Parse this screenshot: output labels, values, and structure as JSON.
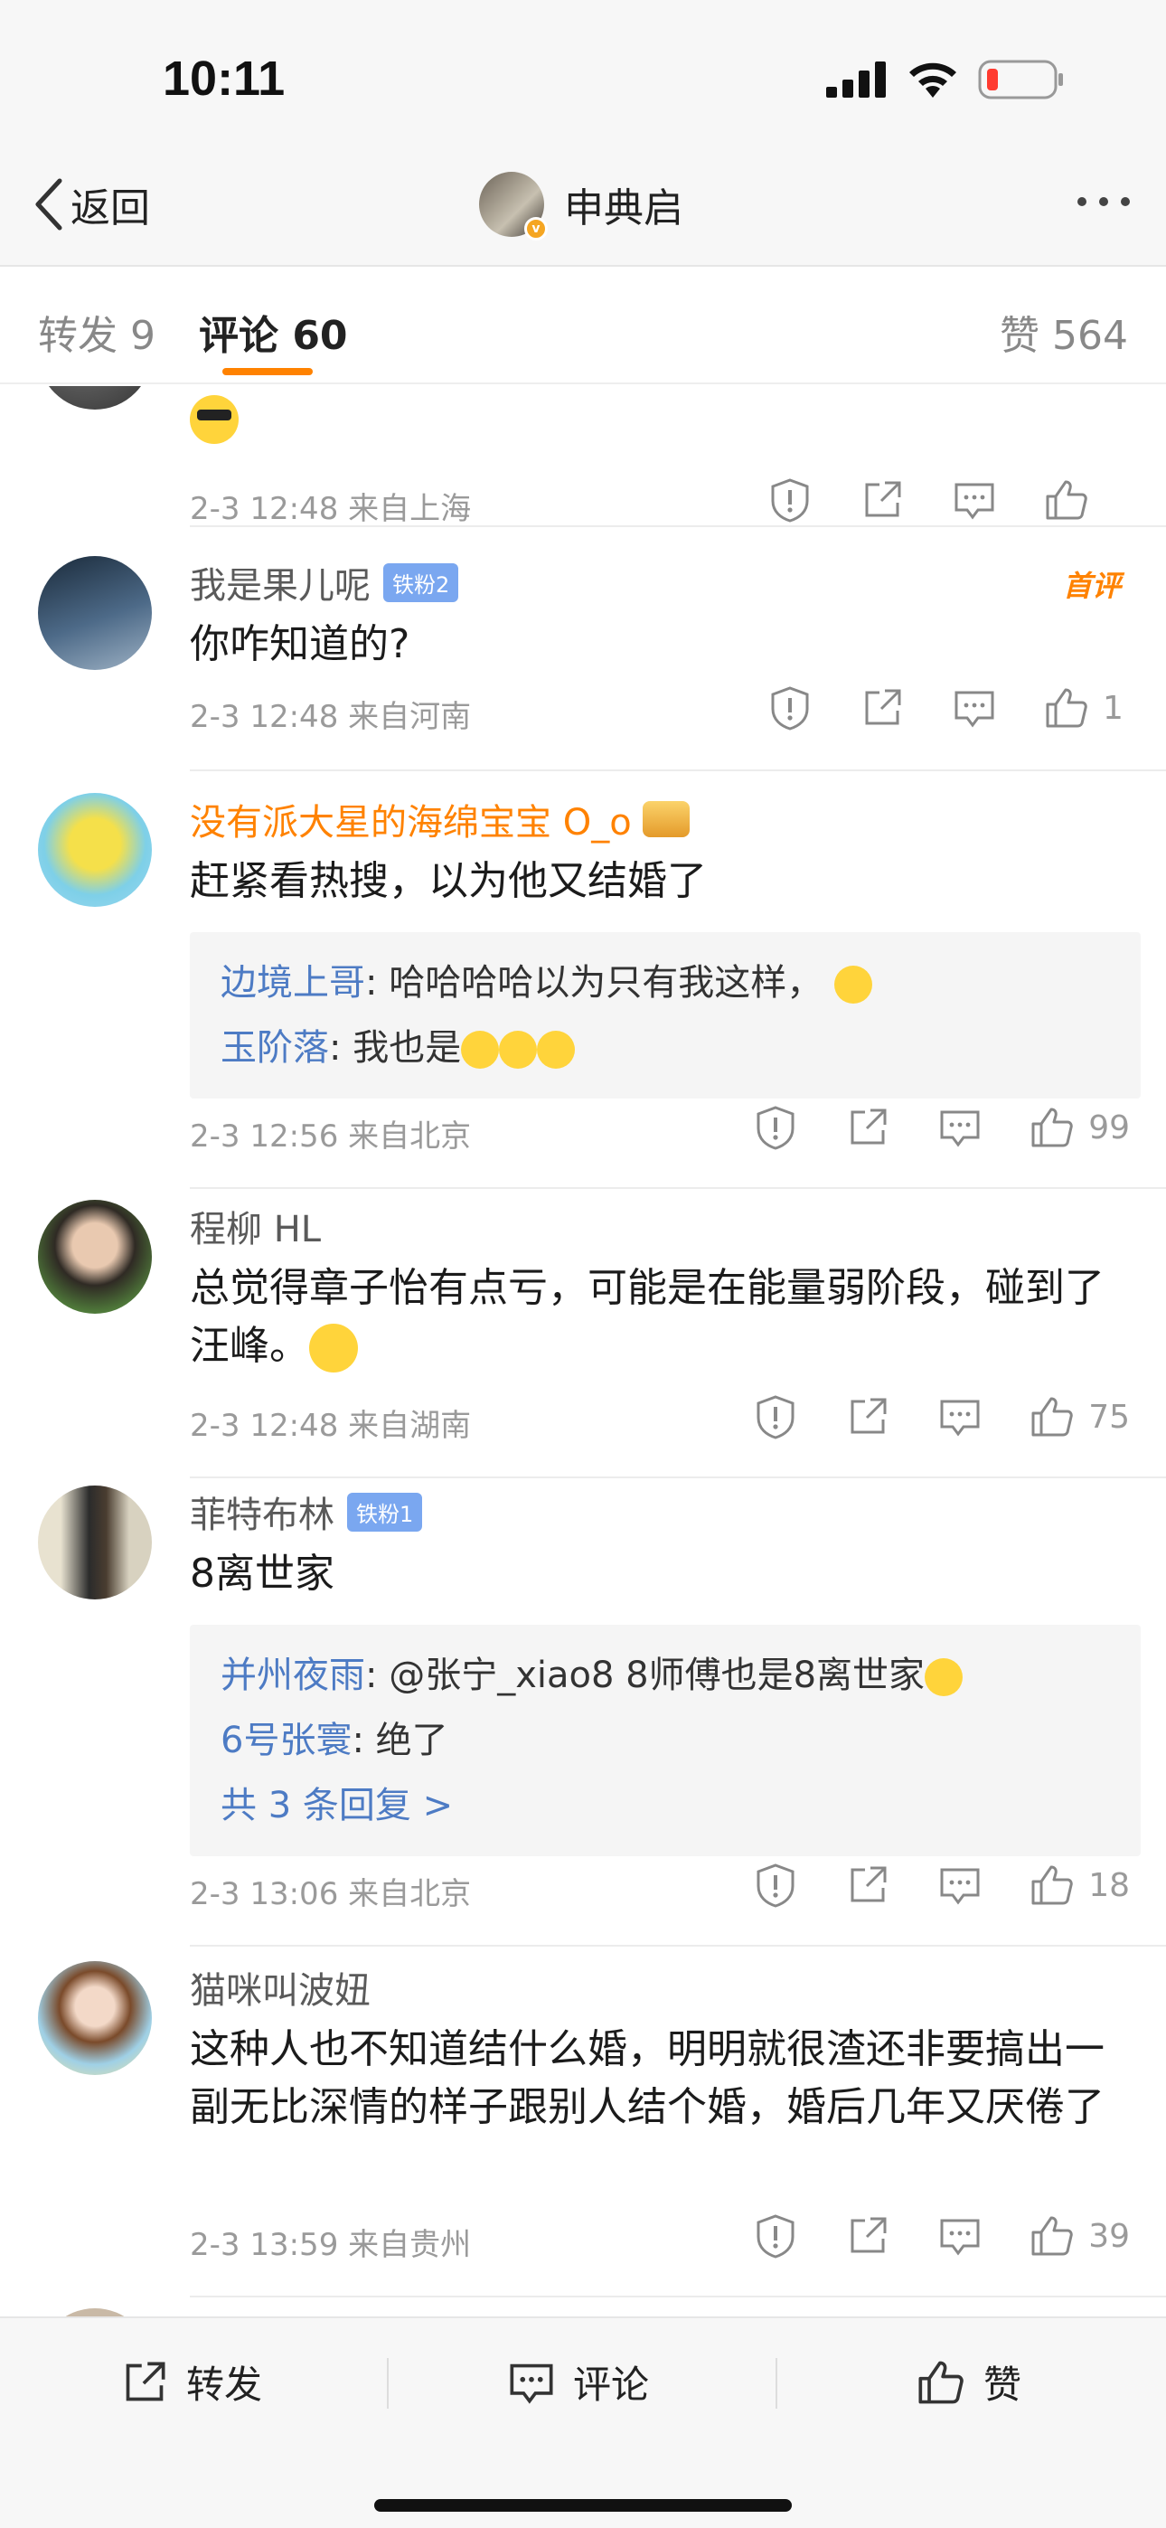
{
  "status_bar": {
    "time": "10:11"
  },
  "nav": {
    "back_label": "返回",
    "title": "申典启"
  },
  "tabs": {
    "repost": "转发 9",
    "comment": "评论 60",
    "like": "赞 564",
    "accent_color": "#ff8200"
  },
  "comments": [
    {
      "id": "c0",
      "name": "",
      "text": "",
      "time": "2-3 12:48",
      "location": "来自上海",
      "likes": ""
    },
    {
      "id": "c1",
      "name": "我是果儿呢",
      "badge": "铁粉2",
      "tag": "首评",
      "text": "你咋知道的?",
      "time": "2-3 12:48",
      "location": "来自河南",
      "likes": "1"
    },
    {
      "id": "c2",
      "name": "没有派大星的海绵宝宝 O_o",
      "text": "赶紧看热搜，以为他又结婚了",
      "replies": [
        {
          "who": "边境上哥",
          "text": ": 哈哈哈哈以为只有我这样，"
        },
        {
          "who": "玉阶落",
          "text": ": 我也是"
        }
      ],
      "time": "2-3 12:56",
      "location": "来自北京",
      "likes": "99"
    },
    {
      "id": "c3",
      "name": "程柳 HL",
      "text": "总觉得章子怡有点亏，可能是在能量弱阶段，碰到了汪峰。",
      "time": "2-3 12:48",
      "location": "来自湖南",
      "likes": "75"
    },
    {
      "id": "c4",
      "name": "菲特布林",
      "badge": "铁粉1",
      "text": "8离世家",
      "replies": [
        {
          "who": "并州夜雨",
          "text": ": @张宁_xiao8   8师傅也是8离世家"
        },
        {
          "who": "6号张寰",
          "text": ": 绝了"
        }
      ],
      "more_replies": "共 3 条回复 >",
      "time": "2-3 13:06",
      "location": "来自北京",
      "likes": "18"
    },
    {
      "id": "c5",
      "name": "猫咪叫波妞",
      "text": "这种人也不知道结什么婚，明明就很渣还非要搞出一副无比深情的样子跟别人结个婚，婚后几年又厌倦了",
      "time": "2-3 13:59",
      "location": "来自贵州",
      "likes": "39"
    }
  ],
  "bottom_bar": {
    "repost": "转发",
    "comment": "评论",
    "like": "赞"
  }
}
